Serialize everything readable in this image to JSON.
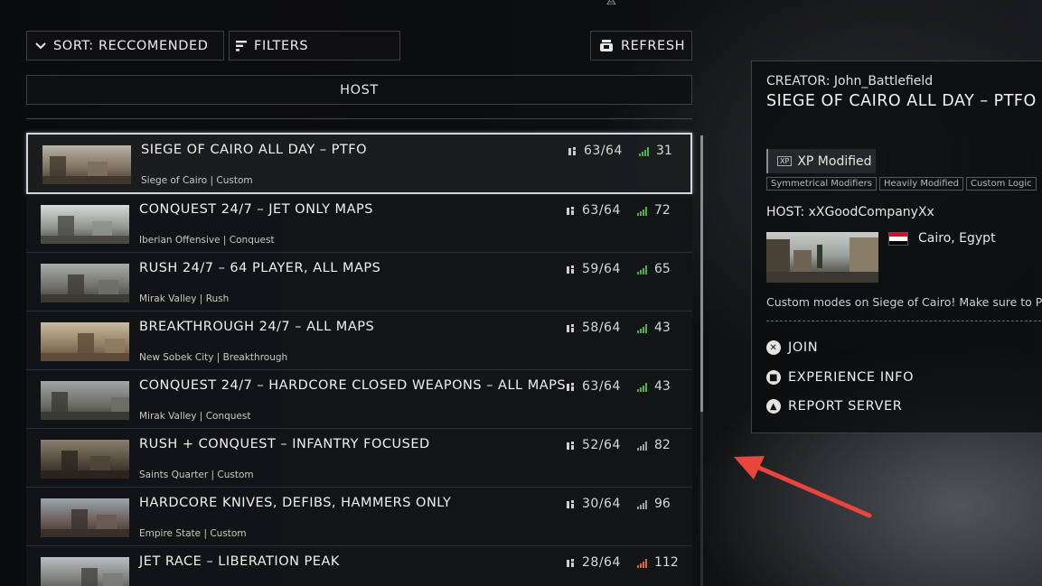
{
  "toolbar": {
    "sort_label": "SORT: RECCOMENDED",
    "filters_label": "FILTERS",
    "refresh_label": "REFRESH"
  },
  "list_header": {
    "host_label": "HOST"
  },
  "servers": [
    {
      "title": "SIEGE OF CAIRO ALL DAY – PTFO",
      "map": "Siege of Cairo",
      "mode": "Custom",
      "players": "63/64",
      "ping": "31",
      "ping_color": "#4caf50",
      "selected": true
    },
    {
      "title": "CONQUEST 24/7 – JET ONLY MAPS",
      "map": "Iberian Offensive",
      "mode": "Conquest",
      "players": "63/64",
      "ping": "72",
      "ping_color": "#4caf50",
      "selected": false
    },
    {
      "title": "RUSH 24/7 – 64  PLAYER, ALL MAPS",
      "map": "Mirak Valley",
      "mode": "Rush",
      "players": "59/64",
      "ping": "65",
      "ping_color": "#4caf50",
      "selected": false
    },
    {
      "title": "BREAKTHROUGH 24/7 – ALL MAPS",
      "map": "New Sobek City",
      "mode": "Breakthrough",
      "players": "58/64",
      "ping": "43",
      "ping_color": "#4caf50",
      "selected": false
    },
    {
      "title": "CONQUEST 24/7 – HARDCORE CLOSED WEAPONS – ALL MAPS",
      "map": "Mirak Valley",
      "mode": "Conquest",
      "players": "63/64",
      "ping": "43",
      "ping_color": "#4caf50",
      "selected": false
    },
    {
      "title": "RUSH + CONQUEST – INFANTRY FOCUSED",
      "map": "Saints Quarter",
      "mode": "Custom",
      "players": "52/64",
      "ping": "82",
      "ping_color": "#9e9e9e",
      "selected": false
    },
    {
      "title": "HARDCORE KNIVES, DEFIBS, HAMMERS ONLY",
      "map": "Empire State",
      "mode": "Custom",
      "players": "30/64",
      "ping": "96",
      "ping_color": "#9e9e9e",
      "selected": false
    },
    {
      "title": "JET RACE – LIBERATION PEAK",
      "map": "",
      "mode": "",
      "players": "28/64",
      "ping": "112",
      "ping_color": "#e0643c",
      "selected": false
    }
  ],
  "detail": {
    "creator": "CREATOR:  John_Battlefield",
    "title": "SIEGE OF CAIRO ALL DAY – PTFO",
    "xp_glyph": "XP",
    "xp_label": "XP Modified",
    "tags": [
      "Symmetrical Modifiers",
      "Heavily Modified",
      "Custom Logic"
    ],
    "host": "HOST:  xXGoodCompanyXx",
    "location": "Cairo, Egypt",
    "description": "Custom modes on Siege of Cairo! Make sure to PTFO",
    "actions": {
      "join": "JOIN",
      "experience_info": "EXPERIENCE INFO",
      "report_server": "REPORT SERVER"
    }
  },
  "colors": {
    "accent_selection": "#cfd6de",
    "arrow": "#e8453c",
    "flag_red": "#ce1126",
    "flag_white": "#ffffff",
    "flag_black": "#000000"
  }
}
